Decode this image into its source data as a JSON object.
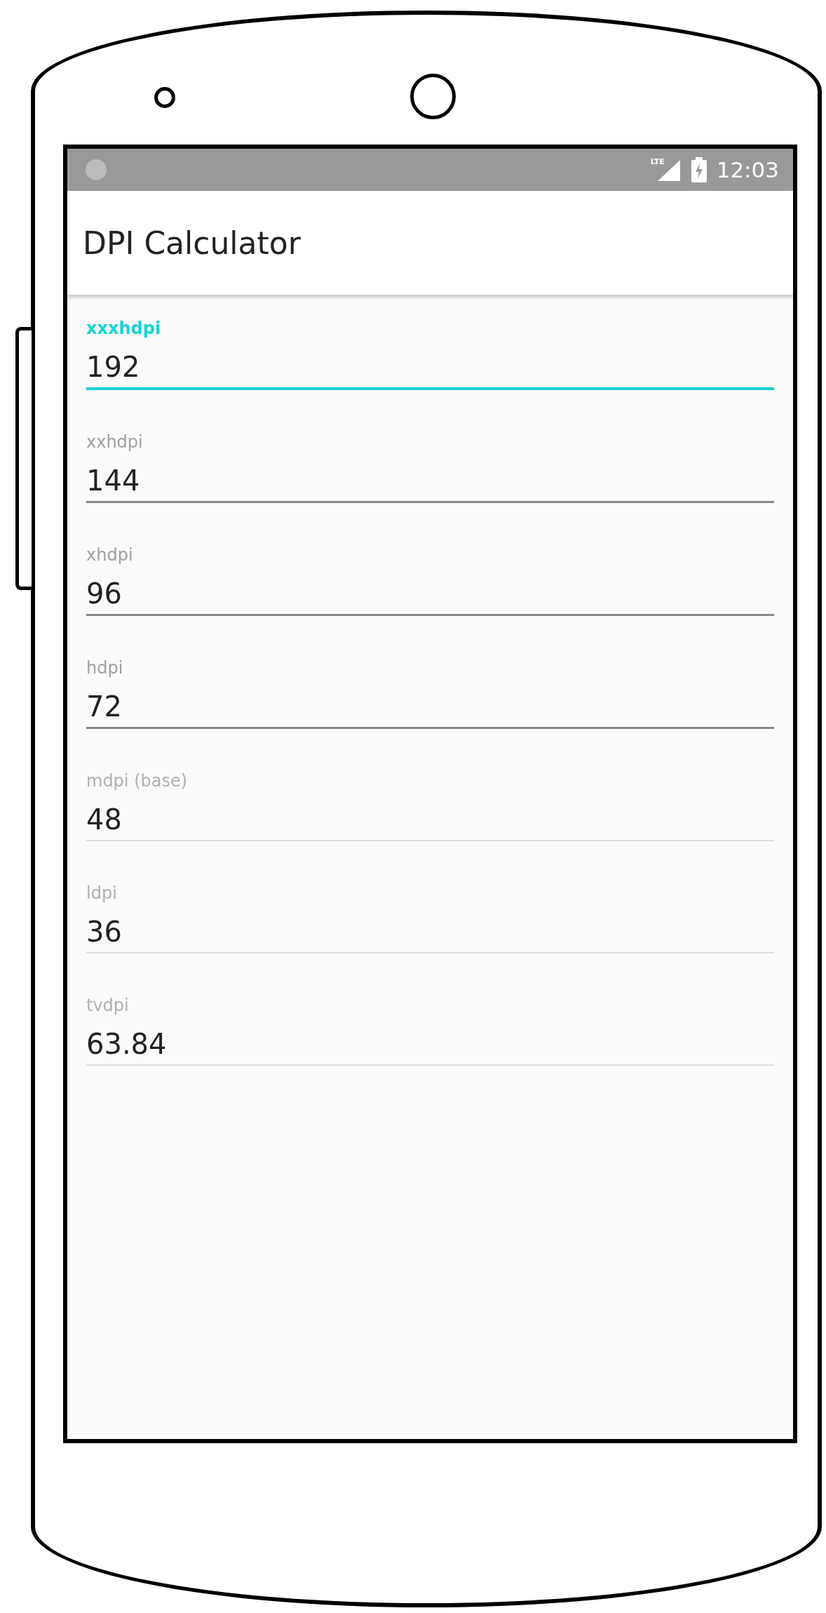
{
  "status_bar": {
    "network": "LTE",
    "time": "12:03"
  },
  "app_bar": {
    "title": "DPI Calculator"
  },
  "fields": [
    {
      "label": "xxxhdpi",
      "value": "192",
      "focused": true,
      "disabled": false
    },
    {
      "label": "xxhdpi",
      "value": "144",
      "focused": false,
      "disabled": false
    },
    {
      "label": "xhdpi",
      "value": "96",
      "focused": false,
      "disabled": false
    },
    {
      "label": "hdpi",
      "value": "72",
      "focused": false,
      "disabled": false
    },
    {
      "label": "mdpi (base)",
      "value": "48",
      "focused": false,
      "disabled": true
    },
    {
      "label": "ldpi",
      "value": "36",
      "focused": false,
      "disabled": true
    },
    {
      "label": "tvdpi",
      "value": "63.84",
      "focused": false,
      "disabled": true
    }
  ]
}
